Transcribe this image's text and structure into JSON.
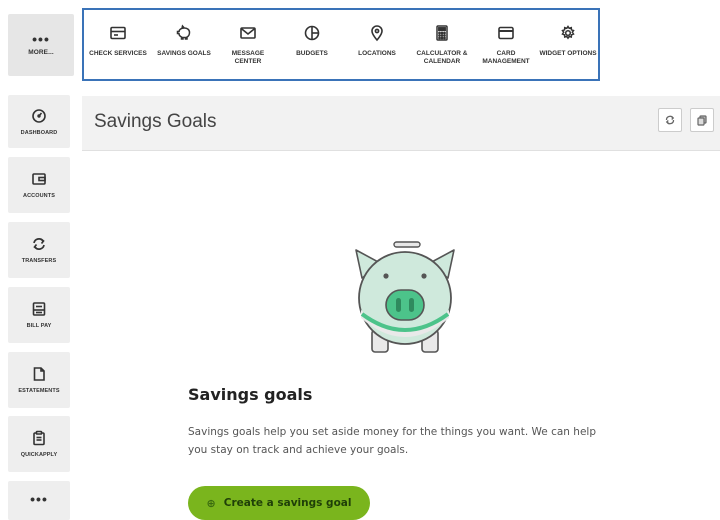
{
  "top_menu": {
    "more_label": "MORE...",
    "items": [
      {
        "label": "CHECK SERVICES",
        "icon": "check-services-icon"
      },
      {
        "label": "SAVINGS GOALS",
        "icon": "piggy-bank-icon"
      },
      {
        "label": "MESSAGE CENTER",
        "icon": "envelope-icon"
      },
      {
        "label": "BUDGETS",
        "icon": "pie-chart-icon"
      },
      {
        "label": "LOCATIONS",
        "icon": "location-pin-icon"
      },
      {
        "label": "CALCULATOR & CALENDAR",
        "icon": "calculator-icon"
      },
      {
        "label": "CARD MANAGEMENT",
        "icon": "credit-card-icon"
      },
      {
        "label": "WIDGET OPTIONS",
        "icon": "gear-icon"
      }
    ]
  },
  "sidebar": {
    "items": [
      {
        "label": "DASHBOARD",
        "icon": "dashboard-icon"
      },
      {
        "label": "ACCOUNTS",
        "icon": "wallet-icon"
      },
      {
        "label": "TRANSFERS",
        "icon": "transfer-arrows-icon"
      },
      {
        "label": "BILL PAY",
        "icon": "bill-icon"
      },
      {
        "label": "ESTATEMENTS",
        "icon": "document-icon"
      },
      {
        "label": "QUICKAPPLY",
        "icon": "clipboard-icon"
      }
    ],
    "more_dots": "•••"
  },
  "header": {
    "title": "Savings Goals"
  },
  "main": {
    "heading": "Savings goals",
    "description": "Savings goals help you set aside money for the things you want. We can help you stay on track and achieve your goals.",
    "cta_label": "Create a savings goal",
    "cta_icon": "plus-circle-icon"
  },
  "colors": {
    "accent_border": "#3a73b8",
    "cta_green": "#7ab51d",
    "piggy_mint": "#cfe9dc",
    "piggy_green": "#4cc38a"
  }
}
